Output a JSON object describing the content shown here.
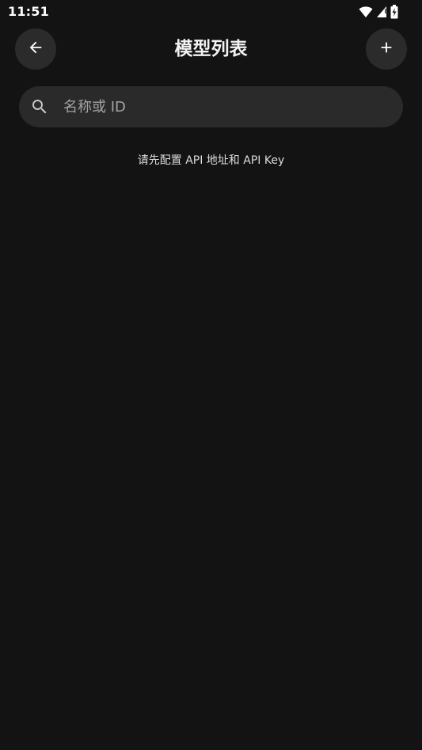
{
  "status_bar": {
    "time": "11:51",
    "icons": [
      "wifi-icon",
      "cell-signal-icon",
      "battery-charging-icon"
    ]
  },
  "app_bar": {
    "title": "模型列表",
    "back_icon": "arrow-left-icon",
    "add_icon": "plus-icon"
  },
  "search": {
    "placeholder": "名称或 ID",
    "value": "",
    "icon": "search-icon"
  },
  "empty_state": {
    "message": "请先配置 API 地址和 API Key"
  },
  "colors": {
    "background": "#131313",
    "surface": "#2a2a2a",
    "text_primary": "#f2f2f2",
    "text_hint": "#a3a3a3"
  }
}
